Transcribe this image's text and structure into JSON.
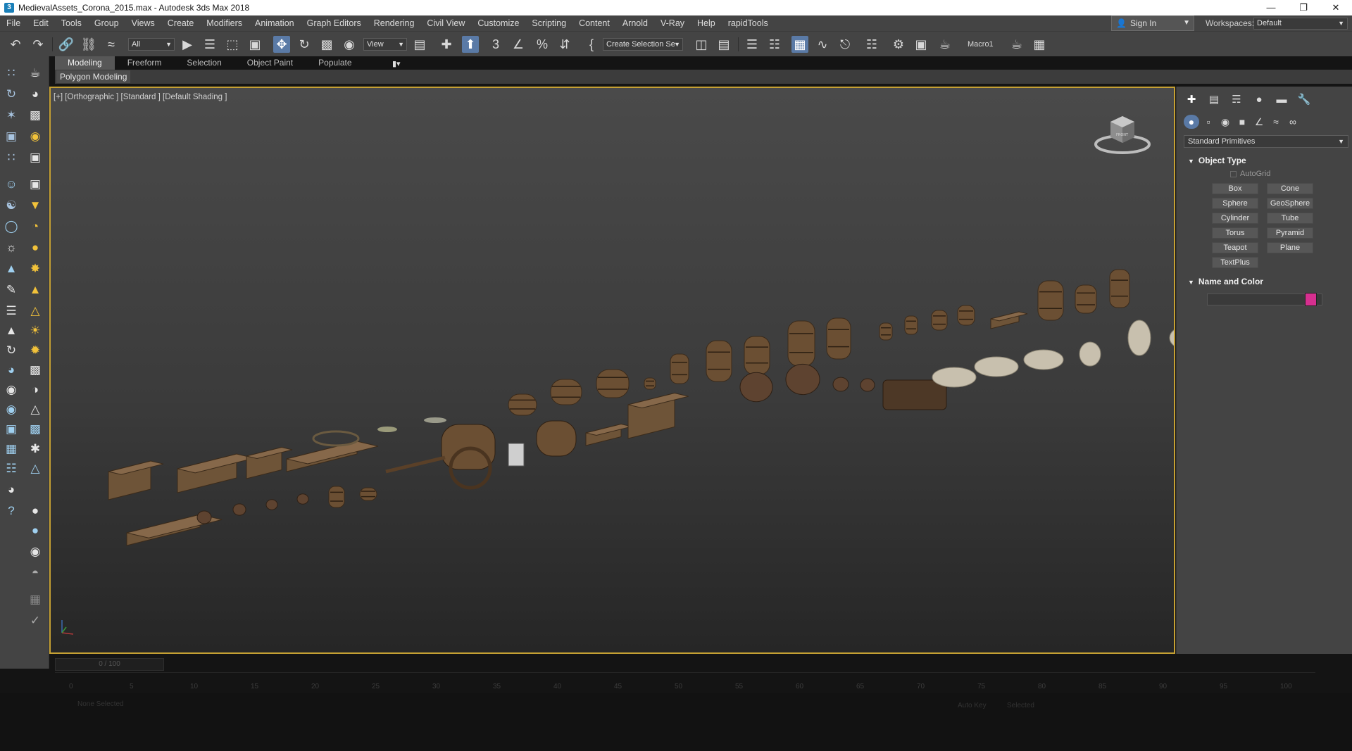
{
  "window": {
    "app_icon": "3",
    "title": "MedievalAssets_Corona_2015.max - Autodesk 3ds Max 2018",
    "minimize": "—",
    "restore": "❐",
    "close": "✕"
  },
  "menu": [
    "File",
    "Edit",
    "Tools",
    "Group",
    "Views",
    "Create",
    "Modifiers",
    "Animation",
    "Graph Editors",
    "Rendering",
    "Civil View",
    "Customize",
    "Scripting",
    "Content",
    "Arnold",
    "V-Ray",
    "Help",
    "rapidTools"
  ],
  "signin": {
    "label": "Sign In",
    "icon": "user-icon"
  },
  "workspaces": {
    "label": "Workspaces:",
    "value": "Default"
  },
  "toolbar": {
    "filter_value": "All",
    "refcoord_value": "View",
    "selection_set_value": "Create Selection Se",
    "macro_label": "Macro1",
    "snap_label": "3",
    "percent_label": "%"
  },
  "ribbon": {
    "tabs": [
      "Modeling",
      "Freeform",
      "Selection",
      "Object Paint",
      "Populate"
    ],
    "active_tab": "Modeling",
    "subpanel": "Polygon Modeling"
  },
  "viewport": {
    "label": "[+] [Orthographic ] [Standard ] [Default Shading ]",
    "viewcube_face": "FRONT"
  },
  "command_panel": {
    "category": "Standard Primitives",
    "object_type_title": "Object Type",
    "autogrid_label": "AutoGrid",
    "buttons": [
      "Box",
      "Cone",
      "Sphere",
      "GeoSphere",
      "Cylinder",
      "Tube",
      "Torus",
      "Pyramid",
      "Teapot",
      "Plane",
      "TextPlus"
    ],
    "name_color_title": "Name and Color",
    "name_value": "",
    "swatch_color": "#d62f8f"
  },
  "timeline": {
    "slider_label": "0 / 100",
    "ticks": [
      "0",
      "5",
      "10",
      "15",
      "20",
      "25",
      "30",
      "35",
      "40",
      "45",
      "50",
      "55",
      "60",
      "65",
      "70",
      "75",
      "80",
      "85",
      "90",
      "95",
      "100"
    ]
  },
  "status": {
    "text": "None Selected",
    "auto_key": "Auto Key",
    "selected": "Selected"
  },
  "colors": {
    "ui_bg": "#444444",
    "viewport_border": "#c5a033",
    "active_blue": "#5a7aa6",
    "wood": "#6b4f33",
    "sack": "#c8c0ae"
  }
}
